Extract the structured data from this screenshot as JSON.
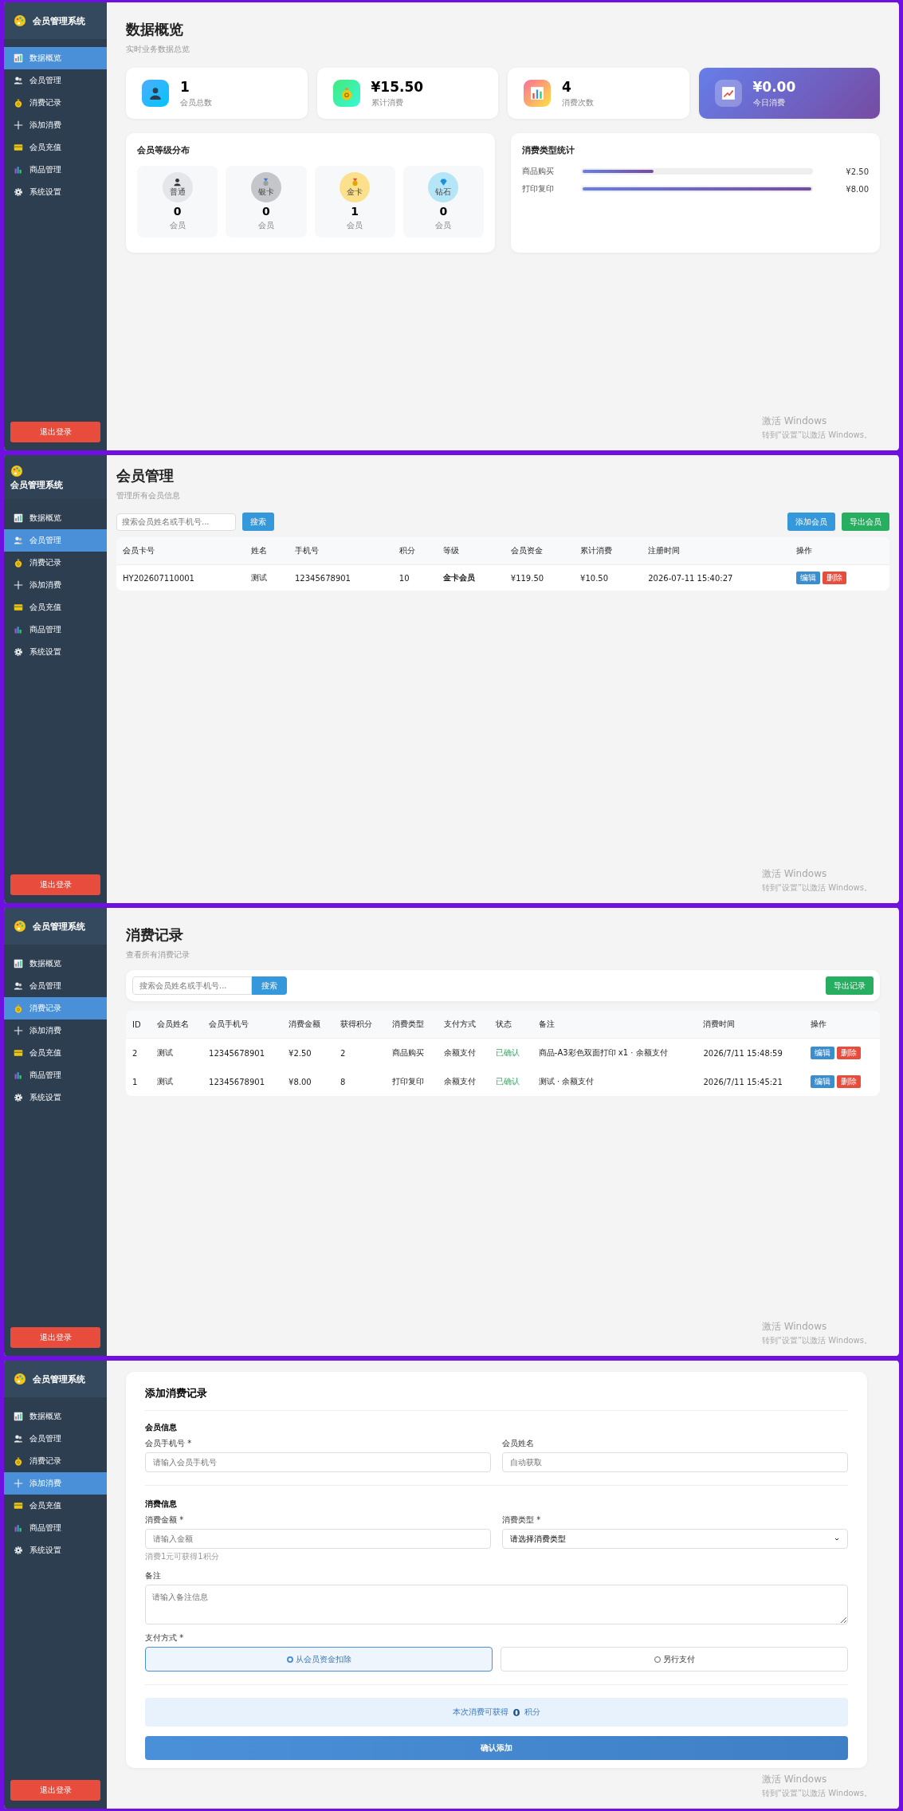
{
  "screens": [
    {
      "kind": "dashboard",
      "sidebar": {
        "title": "会员管理系统",
        "header_stacked": false,
        "items": [
          {
            "label": "数据概览",
            "selected": true
          },
          {
            "label": "会员管理",
            "selected": false
          },
          {
            "label": "消费记录",
            "selected": false
          },
          {
            "label": "添加消费",
            "selected": false
          },
          {
            "label": "会员充值",
            "selected": false
          },
          {
            "label": "商品管理",
            "selected": false
          },
          {
            "label": "系统设置",
            "selected": false
          }
        ],
        "logout": "退出登录"
      },
      "title": "数据概览",
      "subtitle": "实时业务数据总览",
      "stats": [
        {
          "value": "1",
          "label": "会员总数",
          "highlight": false
        },
        {
          "value": "¥15.50",
          "label": "累计消费",
          "highlight": false
        },
        {
          "value": "4",
          "label": "消费次数",
          "highlight": false
        },
        {
          "value": "¥0.00",
          "label": "今日消费",
          "highlight": true
        }
      ],
      "level_panel": {
        "title": "会员等级分布",
        "levels": [
          {
            "badge": "普通",
            "count": "0",
            "label": "会员",
            "color": "#e4e6ea"
          },
          {
            "badge": "银卡",
            "count": "0",
            "label": "会员",
            "color": "#c4c6ca"
          },
          {
            "badge": "金卡",
            "count": "1",
            "label": "会员",
            "color": "#fde08c"
          },
          {
            "badge": "钻石",
            "count": "0",
            "label": "会员",
            "color": "#b5e6f7"
          }
        ]
      },
      "type_panel": {
        "title": "消费类型统计",
        "rows": [
          {
            "label": "商品购买",
            "level": 0.31,
            "amount": "¥2.50"
          },
          {
            "label": "打印复印",
            "level": 1,
            "amount": "¥8.00"
          }
        ]
      },
      "windows_notice": {
        "title": "激活 Windows",
        "text": "转到“设置”以激活 Windows。"
      }
    },
    {
      "kind": "members",
      "sidebar": {
        "title": "会员管理系统",
        "header_stacked": true,
        "items": [
          {
            "label": "数据概览",
            "selected": false
          },
          {
            "label": "会员管理",
            "selected": true
          },
          {
            "label": "消费记录",
            "selected": false
          },
          {
            "label": "添加消费",
            "selected": false
          },
          {
            "label": "会员充值",
            "selected": false
          },
          {
            "label": "商品管理",
            "selected": false
          },
          {
            "label": "系统设置",
            "selected": false
          }
        ],
        "logout": "退出登录"
      },
      "title": "会员管理",
      "subtitle": "管理所有会员信息",
      "search": {
        "placeholder": "搜索会员姓名或手机号...",
        "button": "搜索"
      },
      "buttons": [
        "添加会员",
        "导出会员"
      ],
      "table": {
        "columns": [
          "会员卡号",
          "姓名",
          "手机号",
          "积分",
          "等级",
          "会员资金",
          "累计消费",
          "注册时间",
          "操作"
        ],
        "rows": [
          {
            "cells": [
              "HY202607110001",
              "测试",
              "12345678901",
              "10",
              "金卡会员",
              "¥119.50",
              "¥10.50",
              "2026-07-11 15:40:27"
            ],
            "actions": [
              "编辑",
              "删除"
            ]
          }
        ]
      },
      "windows_notice": {
        "title": "激活 Windows",
        "text": "转到“设置”以激活 Windows。"
      }
    },
    {
      "kind": "records",
      "sidebar": {
        "title": "会员管理系统",
        "header_stacked": false,
        "items": [
          {
            "label": "数据概览",
            "selected": false
          },
          {
            "label": "会员管理",
            "selected": false
          },
          {
            "label": "消费记录",
            "selected": true
          },
          {
            "label": "添加消费",
            "selected": false
          },
          {
            "label": "会员充值",
            "selected": false
          },
          {
            "label": "商品管理",
            "selected": false
          },
          {
            "label": "系统设置",
            "selected": false
          }
        ],
        "logout": "退出登录"
      },
      "title": "消费记录",
      "subtitle": "查看所有消费记录",
      "search": {
        "placeholder": "搜索会员姓名或手机号...",
        "button": "搜索"
      },
      "buttons": [
        "导出记录"
      ],
      "table": {
        "columns": [
          "ID",
          "会员姓名",
          "会员手机号",
          "消费金额",
          "获得积分",
          "消费类型",
          "支付方式",
          "状态",
          "备注",
          "消费时间",
          "操作"
        ],
        "rows": [
          {
            "cells": [
              "2",
              "测试",
              "12345678901",
              "¥2.50",
              "2",
              "商品购买",
              "余额支付",
              "已确认",
              "商品-A3彩色双面打印 x1 · 余额支付",
              "2026/7/11 15:48:59"
            ],
            "actions": [
              "编辑",
              "删除"
            ]
          },
          {
            "cells": [
              "1",
              "测试",
              "12345678901",
              "¥8.00",
              "8",
              "打印复印",
              "余额支付",
              "已确认",
              "测试 · 余额支付",
              "2026/7/11 15:45:21"
            ],
            "actions": [
              "编辑",
              "删除"
            ]
          }
        ]
      },
      "windows_notice": {
        "title": "激活 Windows",
        "text": "转到“设置”以激活 Windows。"
      }
    },
    {
      "kind": "add_record",
      "sidebar": {
        "title": "会员管理系统",
        "header_stacked": false,
        "items": [
          {
            "label": "数据概览",
            "selected": false
          },
          {
            "label": "会员管理",
            "selected": false
          },
          {
            "label": "消费记录",
            "selected": false
          },
          {
            "label": "添加消费",
            "selected": true
          },
          {
            "label": "会员充值",
            "selected": false
          },
          {
            "label": "商品管理",
            "selected": false
          },
          {
            "label": "系统设置",
            "selected": false
          }
        ],
        "logout": "退出登录"
      },
      "form": {
        "title": "添加消费记录",
        "sections": [
          {
            "title": "会员信息",
            "fields": [
              {
                "kind": "input",
                "label": "会员手机号 *",
                "placeholder": "请输入会员手机号"
              },
              {
                "kind": "input",
                "label": "会员姓名",
                "placeholder": "自动获取"
              }
            ]
          },
          {
            "title": "消费信息",
            "fields": [
              {
                "kind": "input",
                "label": "消费金额 *",
                "placeholder": "请输入金额",
                "hint": "消费1元可获得1积分"
              },
              {
                "kind": "select",
                "label": "消费类型 *",
                "value": "请选择消费类型"
              }
            ]
          }
        ],
        "remark": {
          "label": "备注",
          "placeholder": "请输入备注信息"
        },
        "payment": {
          "label": "支付方式 *",
          "options": [
            {
              "label": "从会员资金扣除",
              "selected": true
            },
            {
              "label": "另行支付",
              "selected": false
            }
          ]
        },
        "points_note": "本次消费可获得 **0** 积分",
        "submit": "确认添加"
      },
      "windows_notice": {
        "title": "激活 Windows",
        "text": "转到“设置”以激活 Windows。"
      }
    }
  ]
}
